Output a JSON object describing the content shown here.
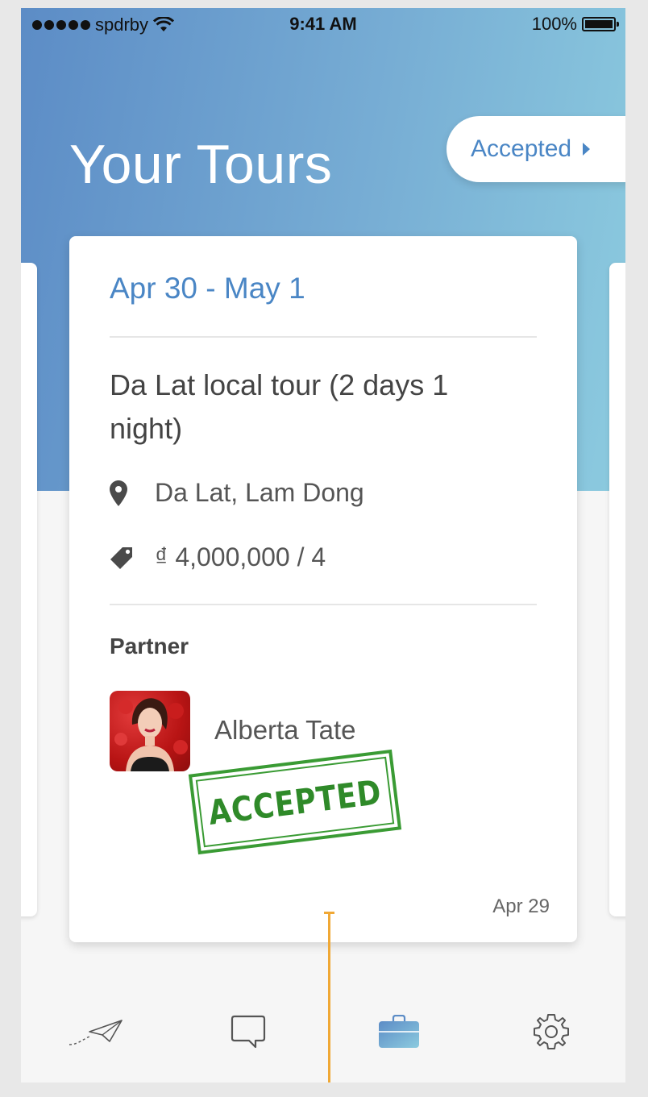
{
  "status_bar": {
    "carrier": "spdrby",
    "time": "9:41 AM",
    "battery": "100%"
  },
  "header": {
    "title": "Your Tours",
    "filter_label": "Accepted"
  },
  "tour": {
    "date_range": "Apr 30 - May 1",
    "name": "Da Lat local tour (2 days 1 night)",
    "location": "Da Lat, Lam Dong",
    "price": "₫ 4,000,000 / 4",
    "partner_label": "Partner",
    "partner_name": "Alberta Tate",
    "stamp": "ACCEPTED",
    "date": "Apr 29"
  },
  "tabs": [
    {
      "name": "send-tab",
      "icon": "paper-plane-icon",
      "active": false
    },
    {
      "name": "messages-tab",
      "icon": "chat-bubble-icon",
      "active": false
    },
    {
      "name": "tours-tab",
      "icon": "briefcase-icon",
      "active": true
    },
    {
      "name": "settings-tab",
      "icon": "gear-icon",
      "active": false
    }
  ],
  "colors": {
    "accent": "#4a86c5",
    "stamp_green": "#3a9b34",
    "guide_orange": "#f0a835"
  }
}
